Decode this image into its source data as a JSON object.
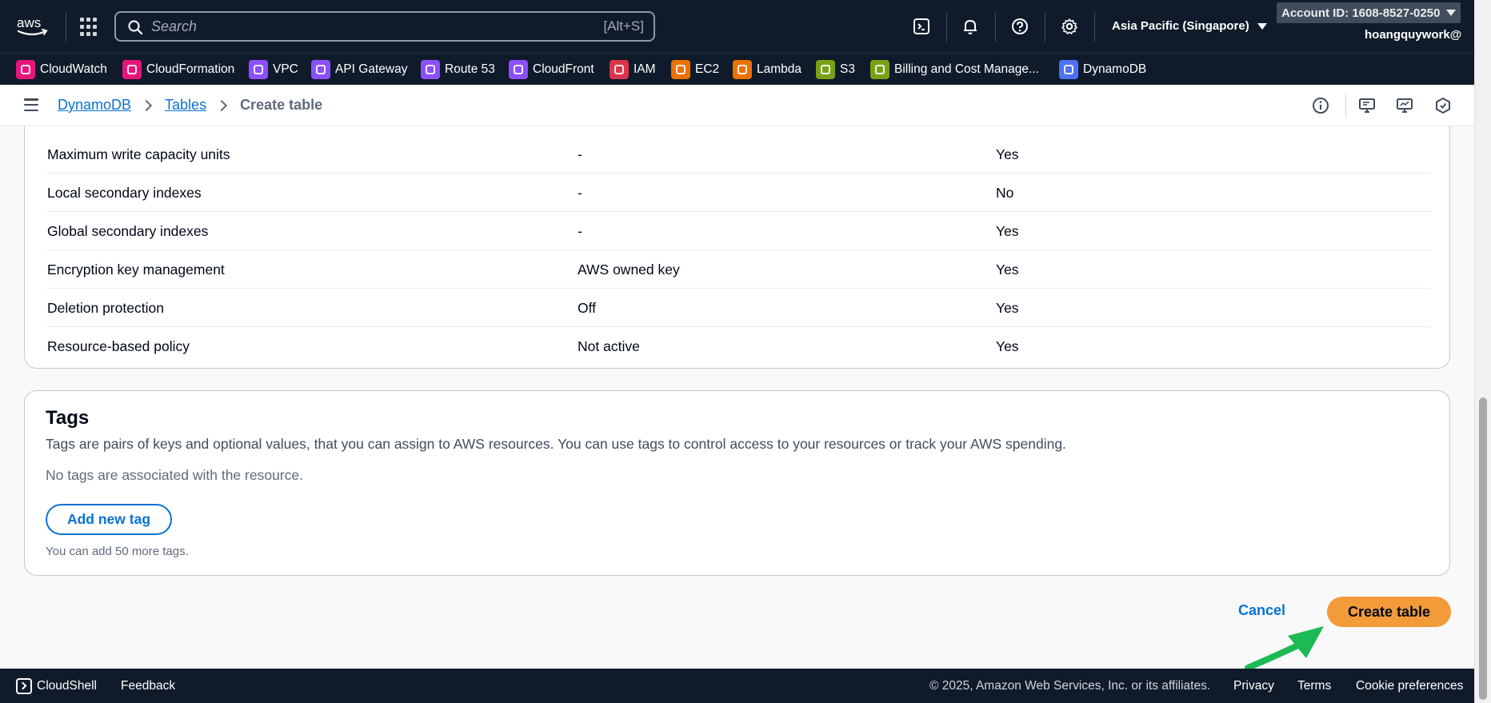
{
  "topnav": {
    "logo_text": "aws",
    "search": {
      "placeholder": "Search",
      "shortcut": "[Alt+S]"
    },
    "icons": [
      "cloudshell-icon",
      "bell-icon",
      "help-icon",
      "gear-icon"
    ],
    "region": "Asia Pacific (Singapore)",
    "account_id": "Account ID: 1608-8527-0250",
    "username": "hoangquywork@"
  },
  "favorites": [
    {
      "label": "CloudWatch",
      "color": "#e7157b"
    },
    {
      "label": "CloudFormation",
      "color": "#e7157b"
    },
    {
      "label": "VPC",
      "color": "#8c4fff"
    },
    {
      "label": "API Gateway",
      "color": "#8c4fff"
    },
    {
      "label": "Route 53",
      "color": "#8c4fff"
    },
    {
      "label": "CloudFront",
      "color": "#8c4fff"
    },
    {
      "label": "IAM",
      "color": "#dd344c"
    },
    {
      "label": "EC2",
      "color": "#ed7100"
    },
    {
      "label": "Lambda",
      "color": "#ed7100"
    },
    {
      "label": "S3",
      "color": "#7aa116"
    },
    {
      "label": "Billing and Cost Manage...",
      "color": "#7aa116"
    },
    {
      "label": "DynamoDB",
      "color": "#4d72f3"
    }
  ],
  "breadcrumb": {
    "items": [
      "DynamoDB",
      "Tables"
    ],
    "current": "Create table"
  },
  "settings_rows": [
    {
      "setting": "Maximum write capacity units",
      "value": "-",
      "editable": "Yes"
    },
    {
      "setting": "Local secondary indexes",
      "value": "-",
      "editable": "No"
    },
    {
      "setting": "Global secondary indexes",
      "value": "-",
      "editable": "Yes"
    },
    {
      "setting": "Encryption key management",
      "value": "AWS owned key",
      "editable": "Yes"
    },
    {
      "setting": "Deletion protection",
      "value": "Off",
      "editable": "Yes"
    },
    {
      "setting": "Resource-based policy",
      "value": "Not active",
      "editable": "Yes"
    }
  ],
  "tags": {
    "title": "Tags",
    "description": "Tags are pairs of keys and optional values, that you can assign to AWS resources. You can use tags to control access to your resources or track your AWS spending.",
    "empty_message": "No tags are associated with the resource.",
    "add_button": "Add new tag",
    "hint": "You can add 50 more tags."
  },
  "actions": {
    "cancel": "Cancel",
    "create": "Create table"
  },
  "footer": {
    "cloudshell": "CloudShell",
    "feedback": "Feedback",
    "copyright": "© 2025, Amazon Web Services, Inc. or its affiliates.",
    "privacy": "Privacy",
    "terms": "Terms",
    "cookies": "Cookie preferences"
  },
  "colors": {
    "nav_bg": "#0f1b2a",
    "link": "#0972d3",
    "primary_button": "#f29b38",
    "annotation_arrow": "#1db954"
  }
}
